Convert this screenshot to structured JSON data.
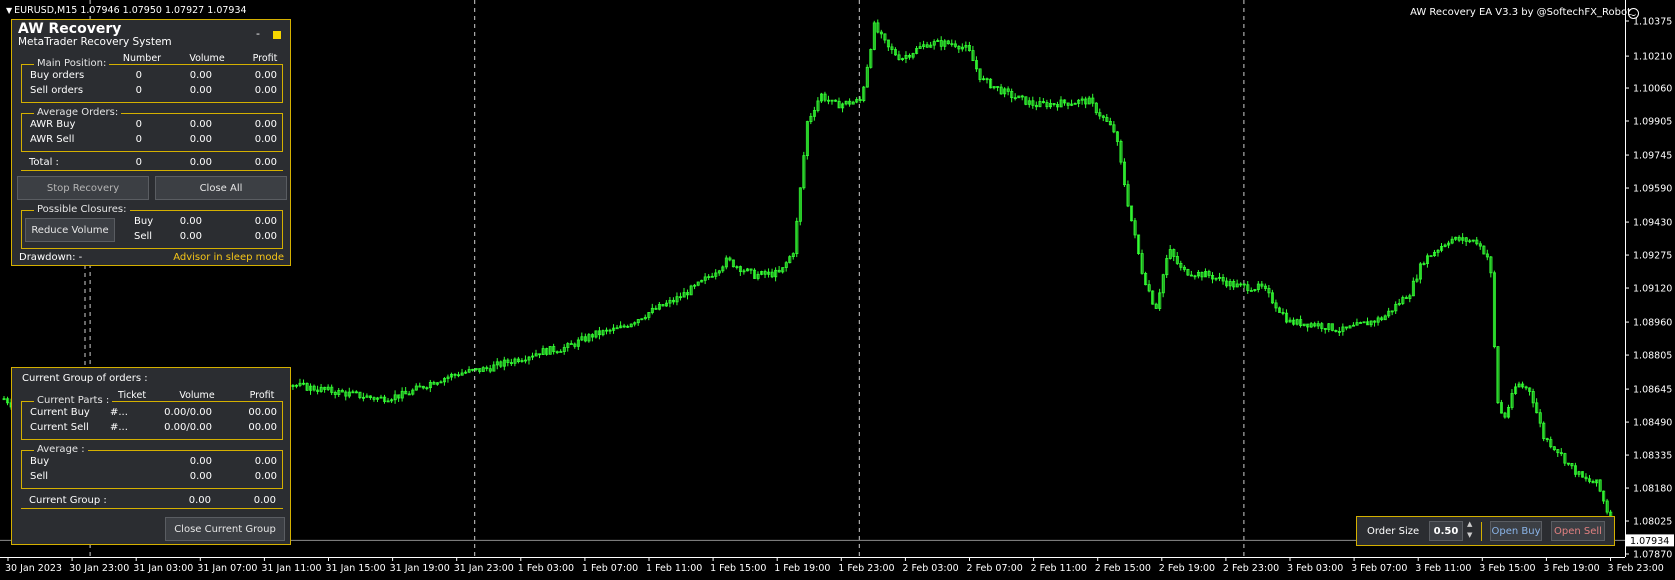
{
  "chart": {
    "symbol_line": "EURUSD,M15  1.07946 1.07950 1.07927 1.07934",
    "ea_title": "AW Recovery EA  V3.3 by @SoftechFX_Robot",
    "current_price_label": "1.07934",
    "colors": {
      "background": "#000000",
      "candle": "#33ff33",
      "grid": "#ffffff",
      "panel_border": "#d4b000",
      "sleep_text": "#f5c518",
      "open_sell": "#e08080"
    },
    "price_ticks": [
      "1.10375",
      "1.10210",
      "1.10060",
      "1.09905",
      "1.09745",
      "1.09590",
      "1.09430",
      "1.09275",
      "1.09120",
      "1.08960",
      "1.08805",
      "1.08645",
      "1.08490",
      "1.08335",
      "1.08180",
      "1.08025",
      "1.07870"
    ],
    "time_ticks": [
      "30 Jan 2023",
      "30 Jan 23:00",
      "31 Jan 03:00",
      "31 Jan 07:00",
      "31 Jan 11:00",
      "31 Jan 15:00",
      "31 Jan 19:00",
      "31 Jan 23:00",
      "1 Feb 03:00",
      "1 Feb 07:00",
      "1 Feb 11:00",
      "1 Feb 15:00",
      "1 Feb 19:00",
      "1 Feb 23:00",
      "2 Feb 03:00",
      "2 Feb 07:00",
      "2 Feb 11:00",
      "2 Feb 15:00",
      "2 Feb 19:00",
      "2 Feb 23:00",
      "3 Feb 03:00",
      "3 Feb 07:00",
      "3 Feb 11:00",
      "3 Feb 15:00",
      "3 Feb 19:00",
      "3 Feb 23:00"
    ],
    "price_path": [
      [
        0,
        1.086
      ],
      [
        0.5,
        1.0858
      ],
      [
        3,
        1.0818
      ],
      [
        7,
        1.0829
      ],
      [
        9,
        1.0834
      ],
      [
        11,
        1.0845
      ],
      [
        13,
        1.0856
      ],
      [
        14,
        1.0852
      ],
      [
        16,
        1.0866
      ],
      [
        18,
        1.0872
      ],
      [
        20,
        1.087
      ],
      [
        22,
        1.0866
      ],
      [
        24,
        1.0864
      ],
      [
        26,
        1.0862
      ],
      [
        28,
        1.086
      ],
      [
        30,
        1.0862
      ],
      [
        32,
        1.0868
      ],
      [
        34,
        1.0872
      ],
      [
        36,
        1.0874
      ],
      [
        38,
        1.0878
      ],
      [
        40,
        1.0882
      ],
      [
        42,
        1.0884
      ],
      [
        44,
        1.089
      ],
      [
        46,
        1.0893
      ],
      [
        48,
        1.09
      ],
      [
        50,
        1.0906
      ],
      [
        52,
        1.0914
      ],
      [
        54,
        1.0925
      ],
      [
        56,
        1.0918
      ],
      [
        58,
        1.0919
      ],
      [
        59,
        1.093
      ],
      [
        60,
        1.099
      ],
      [
        61,
        1.1003
      ],
      [
        62,
        1.0998
      ],
      [
        64,
        1.1
      ],
      [
        65,
        1.1035
      ],
      [
        66,
        1.1025
      ],
      [
        67,
        1.102
      ],
      [
        69,
        1.1027
      ],
      [
        71,
        1.1027
      ],
      [
        72,
        1.1024
      ],
      [
        73,
        1.101
      ],
      [
        75,
        1.1003
      ],
      [
        77,
        1.0998
      ],
      [
        79,
        1.0999
      ],
      [
        81,
        1.1
      ],
      [
        83,
        1.0985
      ],
      [
        84,
        1.095
      ],
      [
        85,
        1.092
      ],
      [
        86,
        1.0902
      ],
      [
        87,
        1.093
      ],
      [
        88,
        1.092
      ],
      [
        90,
        1.0918
      ],
      [
        92,
        1.0913
      ],
      [
        94,
        1.0912
      ],
      [
        96,
        1.0896
      ],
      [
        98,
        1.0895
      ],
      [
        100,
        1.0892
      ],
      [
        103,
        1.0898
      ],
      [
        105,
        1.091
      ],
      [
        106,
        1.0925
      ],
      [
        108,
        1.0935
      ],
      [
        110,
        1.0934
      ],
      [
        111,
        1.0925
      ],
      [
        111.5,
        1.086
      ],
      [
        112,
        1.085
      ],
      [
        113,
        1.0867
      ],
      [
        114,
        1.0864
      ],
      [
        115,
        1.0842
      ],
      [
        116,
        1.0836
      ],
      [
        117,
        1.0828
      ],
      [
        118,
        1.0822
      ],
      [
        119,
        1.082
      ],
      [
        120,
        1.0803
      ]
    ]
  },
  "recovery_panel": {
    "title": "AW Recovery",
    "subtitle": "MetaTrader Recovery System",
    "minimize": "-",
    "columns": {
      "number": "Number",
      "volume": "Volume",
      "profit": "Profit"
    },
    "main_position": {
      "title": "Main Position:",
      "rows": [
        {
          "label": "Buy orders",
          "number": "0",
          "volume": "0.00",
          "profit": "0.00"
        },
        {
          "label": "Sell orders",
          "number": "0",
          "volume": "0.00",
          "profit": "0.00"
        }
      ]
    },
    "average_orders": {
      "title": "Average Orders:",
      "rows": [
        {
          "label": "AWR Buy",
          "number": "0",
          "volume": "0.00",
          "profit": "0.00"
        },
        {
          "label": "AWR Sell",
          "number": "0",
          "volume": "0.00",
          "profit": "0.00"
        }
      ]
    },
    "total": {
      "label": "Total :",
      "number": "0",
      "volume": "0.00",
      "profit": "0.00"
    },
    "stop_recovery": "Stop Recovery",
    "close_all": "Close All",
    "possible_closures": {
      "title": "Possible Closures:",
      "reduce_volume": "Reduce Volume",
      "rows": [
        {
          "label": "Buy",
          "volume": "0.00",
          "profit": "0.00"
        },
        {
          "label": "Sell",
          "volume": "0.00",
          "profit": "0.00"
        }
      ]
    },
    "drawdown": "Drawdown: -",
    "status": "Advisor in sleep mode"
  },
  "group_panel": {
    "title": "Current Group of orders :",
    "columns": {
      "ticket": "Ticket",
      "volume": "Volume",
      "profit": "Profit"
    },
    "current_parts": {
      "title": "Current Parts :",
      "rows": [
        {
          "label": "Current Buy",
          "ticket": "#...",
          "volume": "0.00/0.00",
          "profit": "00.00"
        },
        {
          "label": "Current Sell",
          "ticket": "#...",
          "volume": "0.00/0.00",
          "profit": "00.00"
        }
      ]
    },
    "average": {
      "title": "Average :",
      "rows": [
        {
          "label": "Buy",
          "volume": "0.00",
          "profit": "0.00"
        },
        {
          "label": "Sell",
          "volume": "0.00",
          "profit": "0.00"
        }
      ]
    },
    "current_group": {
      "label": "Current Group :",
      "volume": "0.00",
      "profit": "0.00"
    },
    "close_button": "Close Current Group"
  },
  "order_panel": {
    "label": "Order Size",
    "value": "0.50",
    "open_buy": "Open Buy",
    "open_sell": "Open Sell"
  }
}
